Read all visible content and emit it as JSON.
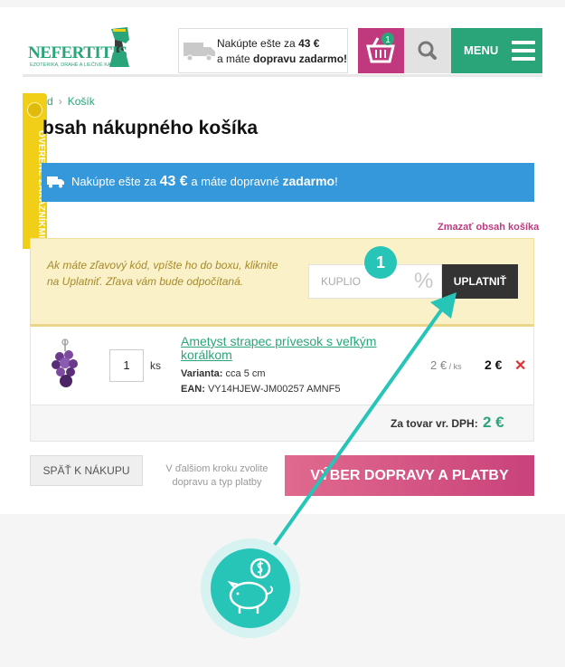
{
  "header": {
    "logo_text": "NEFERTITIS",
    "logo_subtext": "EZOTERIKA, DRAHÉ A LIEČIVÉ KAMENY",
    "shipping_line1_prefix": "Nakúpte ešte za ",
    "shipping_line1_amount": "43 €",
    "shipping_line2_prefix": "a máte ",
    "shipping_line2_bold": "dopravu zadarmo!",
    "cart_count": "1",
    "menu_label": "MENU"
  },
  "side_tab": {
    "label": "OVERENÉ ZÁKAZNÍKMI"
  },
  "breadcrumb": {
    "home": "d",
    "current": "Košík"
  },
  "page_title": "bsah nákupného košíka",
  "free_shipping_bar": {
    "prefix": "Nakúpte ešte za ",
    "amount": "43 €",
    "middle": " a máte dopravné ",
    "bold": "zadarmo",
    "suffix": "!"
  },
  "clear_cart": "Zmazať obsah košíka",
  "coupon": {
    "hint": "Ak máte zľavový kód, vpíšte ho do boxu, kliknite na Uplatniť. Zľava vám bude odpočítaná.",
    "value": "KUPLIO",
    "percent_symbol": "%",
    "apply_label": "UPLATNIŤ",
    "step_number": "1"
  },
  "cart_item": {
    "quantity": "1",
    "unit": "ks",
    "name": "Ametyst strapec prívesok s veľkým korálkom",
    "variant_label": "Varianta:",
    "variant_value": " cca 5 cm",
    "ean_label": "EAN:",
    "ean_value": " VY14HJEW-JM00257 AMNF5",
    "unit_price": "2 €",
    "unit_price_per": " / ks",
    "line_price": "2 €",
    "remove_symbol": "✕"
  },
  "total": {
    "label": "Za tovar vr. DPH:",
    "value": "2 €"
  },
  "actions": {
    "back_label": "SPÄŤ K NÁKUPU",
    "next_note": "V ďalšiom kroku zvolite dopravu a typ platby",
    "continue_label": "VÝBER DOPRAVY A PLATBY"
  },
  "colors": {
    "brand_green": "#2aa57a",
    "cart_magenta": "#c0397f",
    "info_blue": "#3598db",
    "teal_accent": "#27c4b8"
  },
  "icons": [
    "truck-icon",
    "basket-icon",
    "search-icon",
    "hamburger-icon",
    "remove-icon",
    "piggy-bank-icon"
  ]
}
